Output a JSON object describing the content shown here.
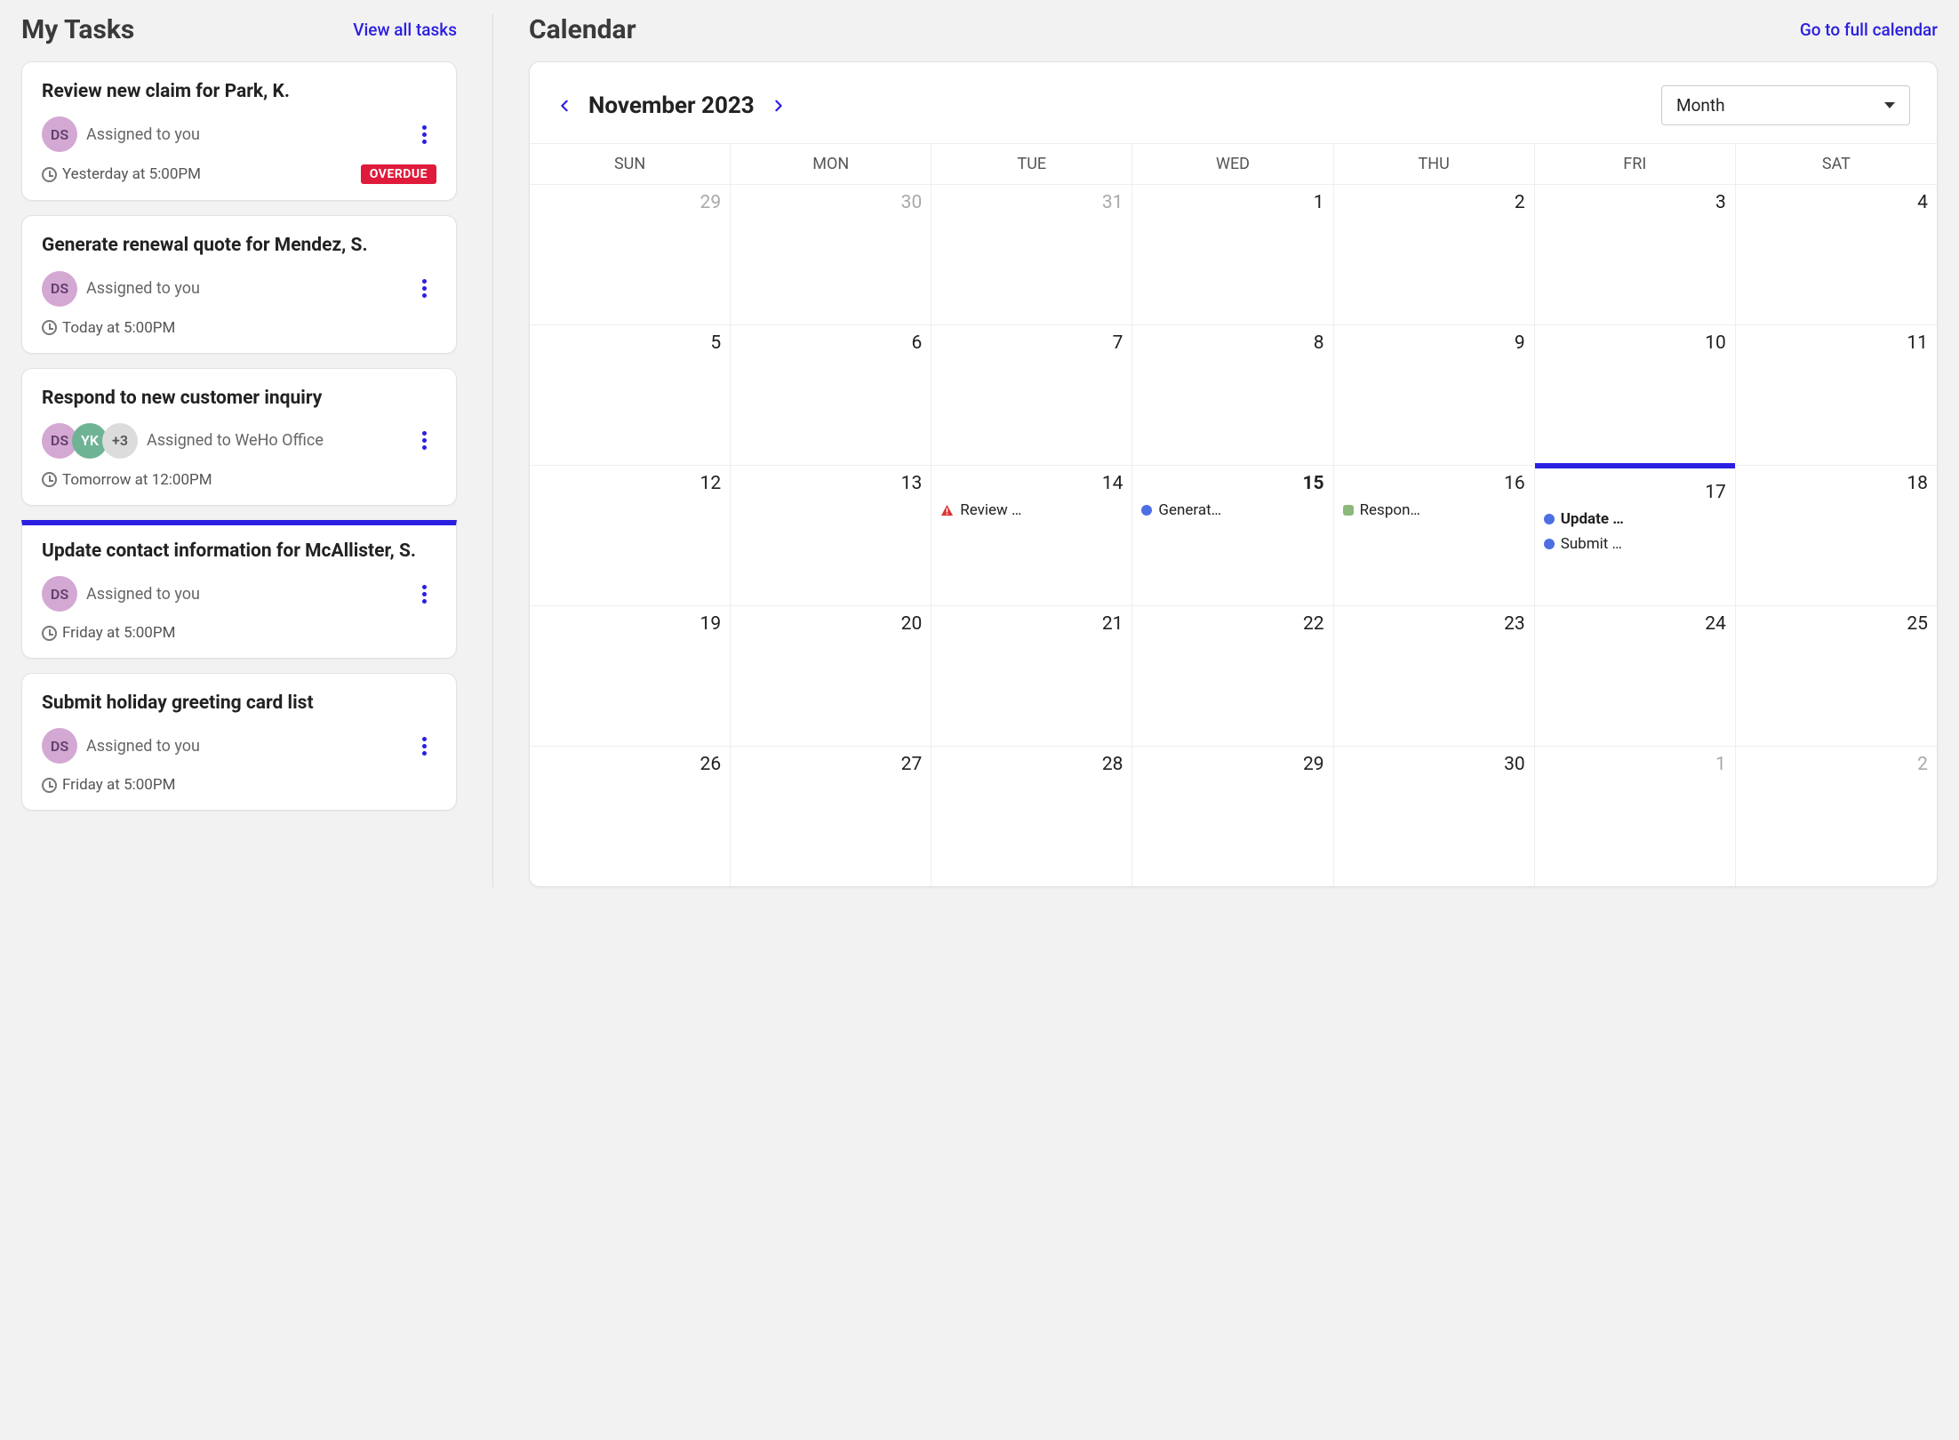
{
  "tasks": {
    "header": "My Tasks",
    "view_all": "View all tasks",
    "items": [
      {
        "title": "Review new claim for Park, K.",
        "avatars": [
          {
            "initials": "DS",
            "cls": "ds"
          }
        ],
        "assigned": "Assigned to you",
        "time": "Yesterday at 5:00PM",
        "overdue": true,
        "overdue_label": "OVERDUE",
        "today_border": false
      },
      {
        "title": "Generate renewal quote for Mendez, S.",
        "avatars": [
          {
            "initials": "DS",
            "cls": "ds"
          }
        ],
        "assigned": "Assigned to you",
        "time": "Today at 5:00PM",
        "overdue": false,
        "today_border": false
      },
      {
        "title": "Respond to new customer inquiry",
        "avatars": [
          {
            "initials": "DS",
            "cls": "ds"
          },
          {
            "initials": "YK",
            "cls": "yk"
          },
          {
            "initials": "+3",
            "cls": "plus"
          }
        ],
        "assigned": "Assigned to WeHo Office",
        "time": "Tomorrow at 12:00PM",
        "overdue": false,
        "today_border": false
      },
      {
        "title": "Update contact information for McAllister, S.",
        "avatars": [
          {
            "initials": "DS",
            "cls": "ds"
          }
        ],
        "assigned": "Assigned to you",
        "time": "Friday at 5:00PM",
        "overdue": false,
        "today_border": true
      },
      {
        "title": "Submit holiday greeting card list",
        "avatars": [
          {
            "initials": "DS",
            "cls": "ds"
          }
        ],
        "assigned": "Assigned to you",
        "time": "Friday at 5:00PM",
        "overdue": false,
        "today_border": false
      }
    ]
  },
  "calendar": {
    "header": "Calendar",
    "full_link": "Go to full calendar",
    "month_label": "November 2023",
    "view_mode": "Month",
    "weekdays": [
      "SUN",
      "MON",
      "TUE",
      "WED",
      "THU",
      "FRI",
      "SAT"
    ],
    "cells": [
      {
        "num": "29",
        "muted": true
      },
      {
        "num": "30",
        "muted": true
      },
      {
        "num": "31",
        "muted": true
      },
      {
        "num": "1"
      },
      {
        "num": "2"
      },
      {
        "num": "3"
      },
      {
        "num": "4"
      },
      {
        "num": "5"
      },
      {
        "num": "6"
      },
      {
        "num": "7"
      },
      {
        "num": "8"
      },
      {
        "num": "9"
      },
      {
        "num": "10"
      },
      {
        "num": "11"
      },
      {
        "num": "12"
      },
      {
        "num": "13"
      },
      {
        "num": "14",
        "events": [
          {
            "icon": "warn",
            "label": "Review …"
          }
        ]
      },
      {
        "num": "15",
        "bold": true,
        "events": [
          {
            "icon": "dot-blue",
            "label": "Generat…"
          }
        ]
      },
      {
        "num": "16",
        "events": [
          {
            "icon": "sq-green",
            "label": "Respon…"
          }
        ]
      },
      {
        "num": "17",
        "today": true,
        "events": [
          {
            "icon": "dot-blue",
            "label": "Update …",
            "bold": true
          },
          {
            "icon": "dot-blue",
            "label": "Submit …"
          }
        ]
      },
      {
        "num": "18"
      },
      {
        "num": "19"
      },
      {
        "num": "20"
      },
      {
        "num": "21"
      },
      {
        "num": "22"
      },
      {
        "num": "23"
      },
      {
        "num": "24"
      },
      {
        "num": "25"
      },
      {
        "num": "26"
      },
      {
        "num": "27"
      },
      {
        "num": "28"
      },
      {
        "num": "29"
      },
      {
        "num": "30"
      },
      {
        "num": "1",
        "muted": true
      },
      {
        "num": "2",
        "muted": true
      }
    ]
  }
}
